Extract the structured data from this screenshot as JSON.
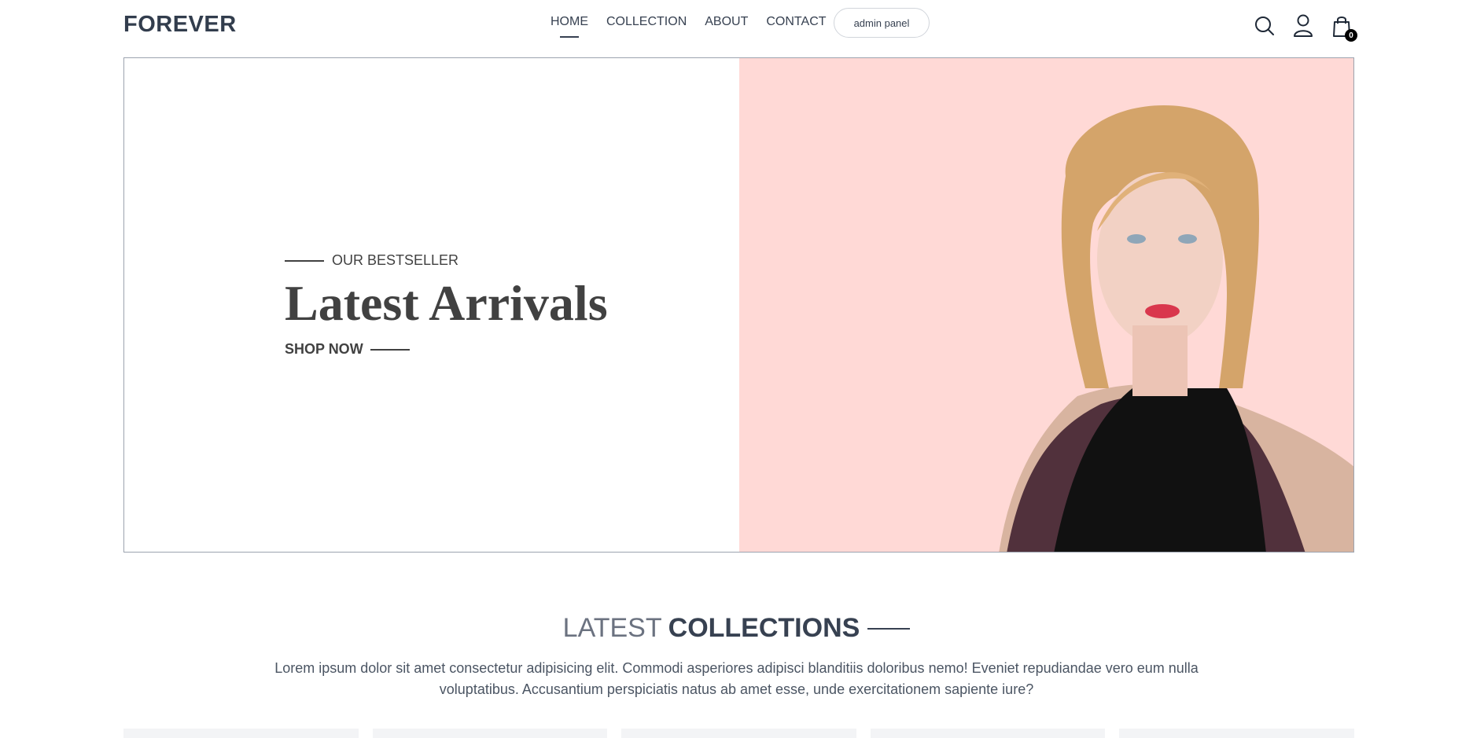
{
  "navbar": {
    "logo": "FOREVER",
    "links": [
      {
        "label": "HOME",
        "active": true
      },
      {
        "label": "COLLECTION",
        "active": false
      },
      {
        "label": "ABOUT",
        "active": false
      },
      {
        "label": "CONTACT",
        "active": false
      }
    ],
    "admin_button": "admin panel",
    "icons": [
      "search-icon",
      "profile-icon",
      "cart-icon"
    ],
    "cart_count": "0"
  },
  "hero": {
    "kicker": "OUR BESTSELLER",
    "title": "Latest Arrivals",
    "cta": "SHOP NOW",
    "image_bg": "#ffd9d6"
  },
  "latest": {
    "title_light": "LATEST",
    "title_bold": "COLLECTIONS",
    "description": "Lorem ipsum dolor sit amet consectetur adipisicing elit. Commodi asperiores adipisci blanditiis doloribus nemo! Eveniet repudiandae vero eum nulla voluptatibus. Accusantium perspiciatis natus ab amet esse, unde exercitationem sapiente iure?"
  }
}
